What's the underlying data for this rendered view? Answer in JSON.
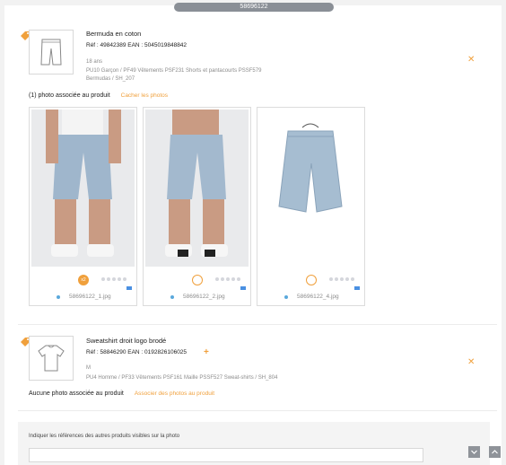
{
  "header": {
    "id_pill": "58696122"
  },
  "products": [
    {
      "name": "Bermuda en coton",
      "ref": "Réf : 49842389    EAN : 5045019848842",
      "size": "18 ans",
      "category": "PU10 Garçon / PF49 Vêtements PSF231 Shorts et pantacourts PSSF579",
      "category2": "Bermudas / SH_207",
      "assoc_text": "(1) photo associée au produit",
      "assoc_link": "Cacher les photos",
      "close": "✕"
    },
    {
      "name": "Sweatshirt droit logo brodé",
      "ref": "Réf : 58846290    EAN : 0192826106025",
      "size": "M",
      "category": "PU4 Homme / PF33 Vêtements PSF161 Maille PSSF527 Sweat-shirts / SH_804",
      "assoc_text": "Aucune photo associée au produit",
      "assoc_link": "Associer des photos au produit",
      "close": "✕",
      "add": "+"
    }
  ],
  "photos": [
    {
      "filename": "58696122_1.jpg",
      "badge": "x2",
      "selected": true
    },
    {
      "filename": "58696122_2.jpg",
      "badge": "",
      "selected": false
    },
    {
      "filename": "58696122_4.jpg",
      "badge": "",
      "selected": false
    }
  ],
  "bottom": {
    "label": "Indiquer les références des autres produits visibles sur la photo",
    "input_value": ""
  },
  "colors": {
    "accent": "#f0a03c",
    "flag": "#4a90e2"
  }
}
